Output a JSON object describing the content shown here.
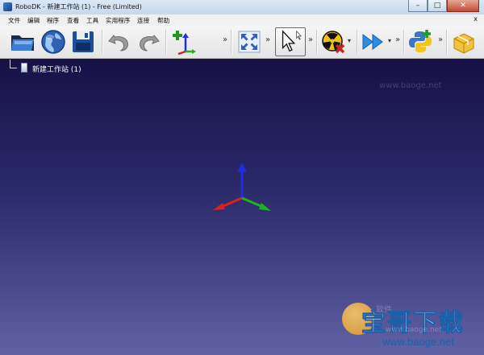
{
  "window": {
    "title": "RoboDK - 新建工作站 (1) - Free (Limited)",
    "min_label": "–",
    "max_label": "□",
    "close_label": "✕"
  },
  "menubar": {
    "items": [
      {
        "label": "文件"
      },
      {
        "label": "编辑"
      },
      {
        "label": "程序"
      },
      {
        "label": "查看"
      },
      {
        "label": "工具"
      },
      {
        "label": "实用程序"
      },
      {
        "label": "连接"
      },
      {
        "label": "帮助"
      }
    ],
    "close_label": "x"
  },
  "toolbar": {
    "overflow_label": "»",
    "dropdown_label": "▾",
    "icons": [
      "open-folder-icon",
      "globe-icon",
      "save-icon",
      "undo-icon",
      "redo-icon",
      "add-reference-frame-icon",
      "fit-all-icon",
      "select-cursor-icon",
      "collision-check-icon",
      "run-program-icon",
      "python-icon",
      "package-icon"
    ]
  },
  "tree": {
    "station_label": "新建工作站 (1)"
  },
  "watermark": {
    "main": "宝哥下载",
    "url": "www.baoge.net",
    "faint1": "软件",
    "faint2": "www.baoge.net",
    "faint3": "www.baoge.net"
  },
  "colors": {
    "viewport_top": "#171146",
    "viewport_bottom": "#5f62a5",
    "axis_x": "#e01e1e",
    "axis_y": "#1fb21f",
    "axis_z": "#1c2fe0"
  }
}
